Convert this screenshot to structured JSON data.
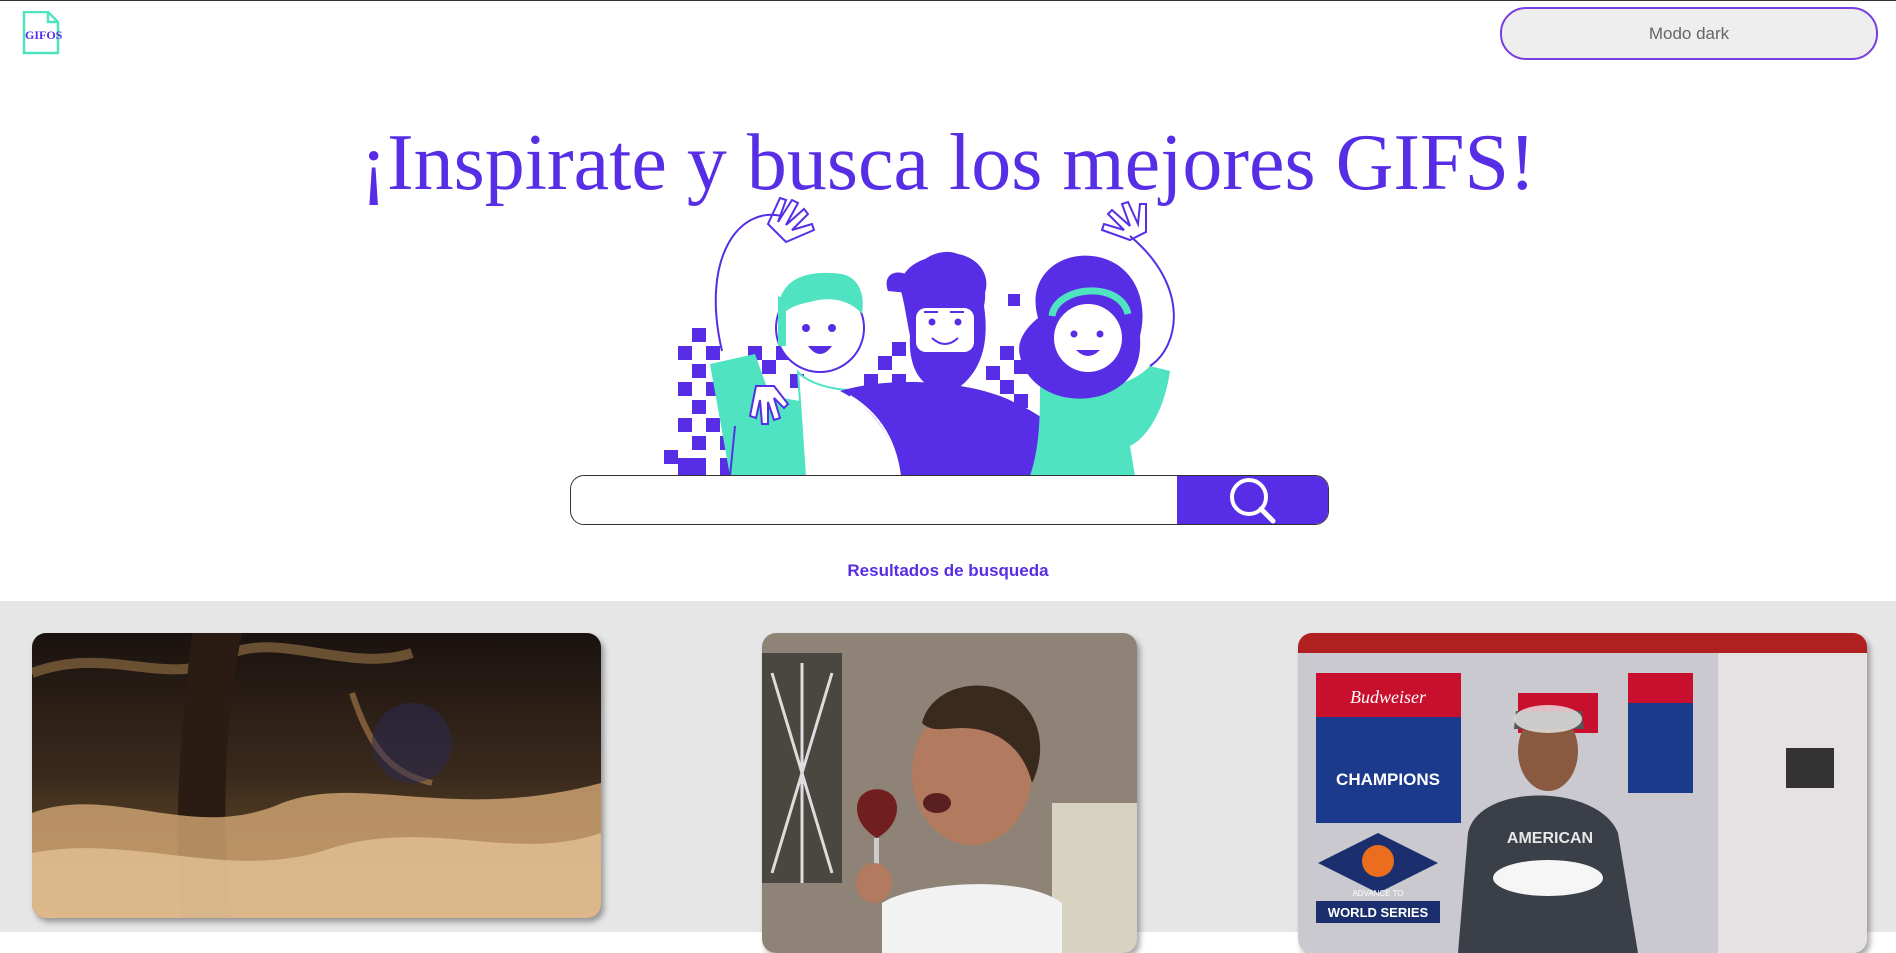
{
  "header": {
    "logo_text": "GIFOS",
    "dark_mode_label": "Modo dark"
  },
  "hero": {
    "title": "¡Inspirate y busca los mejores GIFS!"
  },
  "search": {
    "placeholder": "",
    "value": ""
  },
  "results": {
    "title": "Resultados de busqueda",
    "gifs": [
      {
        "name": "gif-fire-scene",
        "label": ""
      },
      {
        "name": "gif-wine-man",
        "label": ""
      },
      {
        "name": "gif-baseball-champion",
        "label": "",
        "banner_text": "CHAMPIONS",
        "badge_top": "ADVANCE TO",
        "badge_bottom": "WORLD SERIES",
        "shirt_text": "AMERICAN",
        "sponsor": "Budweiser"
      }
    ]
  },
  "colors": {
    "brand": "#572ee5",
    "accent": "#50e3c2",
    "gallery_bg": "#e6e6e6"
  },
  "icons": [
    "document-logo-icon",
    "search-icon"
  ]
}
